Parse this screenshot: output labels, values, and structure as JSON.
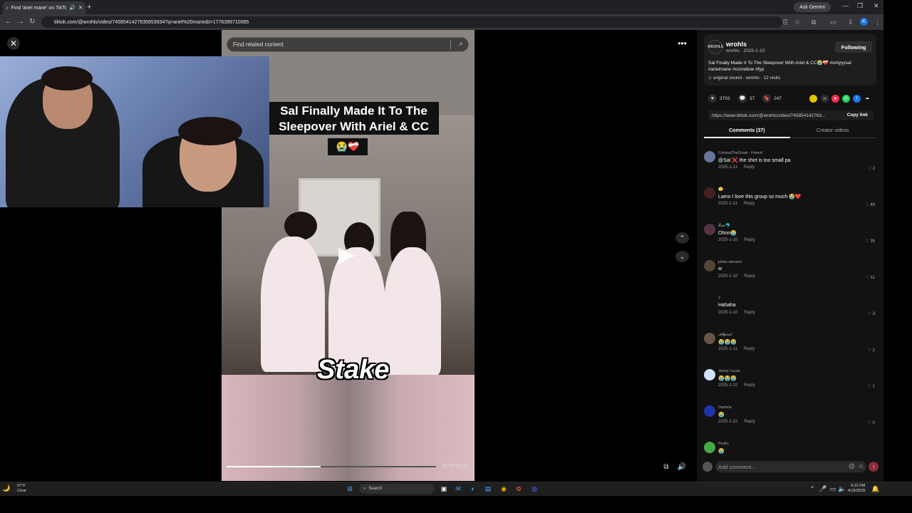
{
  "browser": {
    "tab_title": "Find 'ariel marie' on TikTok",
    "url": "tiktok.com/@wrohls/video/7458541427635653934?q=ariel%20marie&t=1776399710065",
    "ask_gemini": "Ask Gemini",
    "new_tab": "+",
    "profile_initial": "K"
  },
  "video": {
    "search_placeholder": "Find related content",
    "caption_line1": "Sal Finally Made It To The",
    "caption_line2": "Sleepover With Ariel & CC",
    "caption_emoji": "😭❤️‍🩹",
    "watermark": "Stake",
    "time": "00:05/00:11",
    "progress": 0.45
  },
  "post": {
    "username": "wrohls",
    "sub": "wrohls · 2025-1-10",
    "avatar_text": "WROHLS",
    "follow_label": "Following",
    "description": "Sal Finally Made It To The Sleepover With Ariel & CC😭❤️‍🩹 #onlyyysal #arielmarie #ccmellow #fyp",
    "sound": "original sound - wrohls · 12 visits",
    "likes": "3703",
    "comments_count": "37",
    "saves": "247",
    "link": "https://www.tiktok.com/@wrohls/video/745854142763...",
    "copy_link": "Copy link",
    "tab_comments": "Comments (37)",
    "tab_creator": "Creator videos"
  },
  "comments": [
    {
      "user": "CoronaTheGreat · Friend",
      "text": "@Sal ❌ the shirt is too small pa",
      "date": "2025-1-11",
      "likes": "2",
      "color": "#667799"
    },
    {
      "user": "🫣 ·",
      "text": "Lamo I love this group so much 😭❤️",
      "date": "2025-1-11",
      "likes": "49",
      "color": "#442222"
    },
    {
      "user": "𝓔𝓻𝓲𝓬🐬",
      "text": "Ohnn😭",
      "date": "2025-1-10",
      "likes": "35",
      "color": "#553344"
    },
    {
      "user": "julian serrano",
      "text": "w",
      "date": "2025-1-10",
      "likes": "11",
      "color": "#554433"
    },
    {
      "user": "7",
      "text": "Hahaha",
      "date": "2025-1-10",
      "likes": "3",
      "color": "#111111"
    },
    {
      "user": "𝓐𝓵𝓰𝓮𝓷𝓽",
      "text": "😭😭😭",
      "date": "2025-1-11",
      "likes": "2",
      "color": "#665544"
    },
    {
      "user": "Jonny Lucas",
      "text": "😭😭😭",
      "date": "2025-1-10",
      "likes": "1",
      "color": "#cce4ff"
    },
    {
      "user": "Daniela",
      "text": "😭",
      "date": "2025-1-22",
      "likes": "0",
      "color": "#2233aa"
    },
    {
      "user": "Pedro",
      "text": "😭",
      "date": "",
      "likes": "",
      "color": "#44aa44"
    }
  ],
  "reply_label": "Reply",
  "add_comment_placeholder": "Add comment...",
  "taskbar": {
    "weather_temp": "57°F",
    "weather_desc": "Clear",
    "search": "Search",
    "time": "9:22 PM",
    "date": "4/16/2026"
  }
}
